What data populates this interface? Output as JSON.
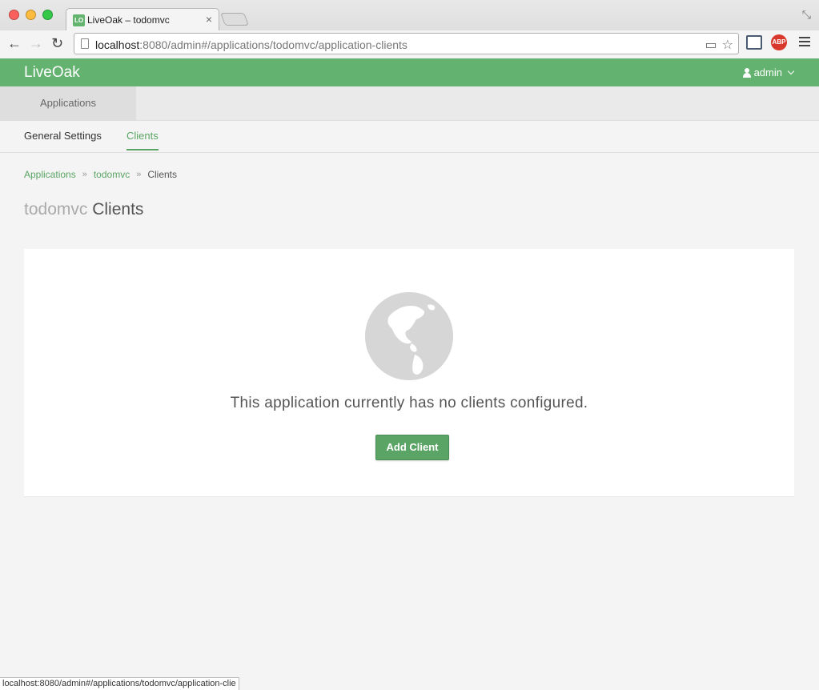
{
  "browser": {
    "tab_title": "LiveOak – todomvc",
    "tab_favicon": "LO",
    "tab_close": "×",
    "url_host": "localhost",
    "url_rest": ":8080/admin#/applications/todomvc/application-clients",
    "abp_label": "ABP",
    "status_url": "localhost:8080/admin#/applications/todomvc/application-clie"
  },
  "header": {
    "brand": "LiveOak",
    "user": "admin"
  },
  "top_nav": {
    "applications": "Applications"
  },
  "sub_nav": {
    "general": "General Settings",
    "clients": "Clients"
  },
  "breadcrumb": {
    "applications": "Applications",
    "app": "todomvc",
    "current": "Clients",
    "separator": "»"
  },
  "title": {
    "app": "todomvc",
    "section": "Clients"
  },
  "empty_state": {
    "icon": "globe-icon",
    "message": "This application currently has no clients configured.",
    "button": "Add Client"
  },
  "colors": {
    "accent": "#64b270",
    "link": "#5aa565"
  }
}
